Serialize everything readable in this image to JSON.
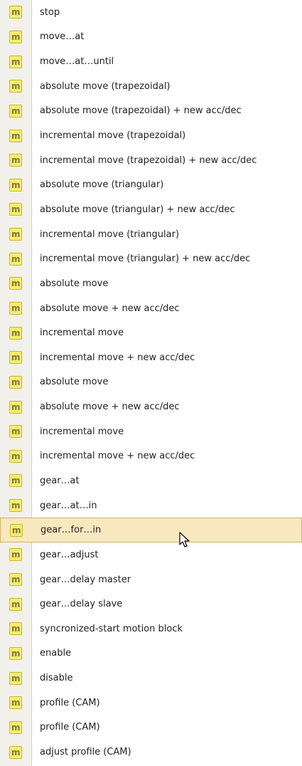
{
  "menu": {
    "icon_glyph": "m",
    "selected_index": 22,
    "items": [
      {
        "label": "stop",
        "icon": "method-icon"
      },
      {
        "label": "move…at",
        "icon": "method-icon"
      },
      {
        "label": "move…at…until",
        "icon": "method-icon"
      },
      {
        "label": "absolute move (trapezoidal)",
        "icon": "method-icon"
      },
      {
        "label": "absolute move (trapezoidal) + new acc/dec",
        "icon": "method-icon"
      },
      {
        "label": "incremental move (trapezoidal)",
        "icon": "method-icon"
      },
      {
        "label": "incremental move (trapezoidal) + new acc/dec",
        "icon": "method-icon"
      },
      {
        "label": "absolute move (triangular)",
        "icon": "method-icon"
      },
      {
        "label": "absolute move (triangular) + new acc/dec",
        "icon": "method-icon"
      },
      {
        "label": "incremental move (triangular)",
        "icon": "method-icon"
      },
      {
        "label": "incremental move (triangular) + new acc/dec",
        "icon": "method-icon"
      },
      {
        "label": "absolute move",
        "icon": "method-icon"
      },
      {
        "label": "absolute move + new acc/dec",
        "icon": "method-icon"
      },
      {
        "label": "incremental move",
        "icon": "method-icon"
      },
      {
        "label": "incremental move + new acc/dec",
        "icon": "method-icon"
      },
      {
        "label": "absolute move",
        "icon": "method-icon"
      },
      {
        "label": "absolute move + new acc/dec",
        "icon": "method-icon"
      },
      {
        "label": "incremental move",
        "icon": "method-icon"
      },
      {
        "label": "incremental move + new acc/dec",
        "icon": "method-icon"
      },
      {
        "label": "gear…at",
        "icon": "method-icon"
      },
      {
        "label": "gear…at…in",
        "icon": "method-icon"
      },
      {
        "label": "gear…for…in",
        "icon": "method-icon"
      },
      {
        "label": "gear…adjust",
        "icon": "method-icon"
      },
      {
        "label": "gear…delay master",
        "icon": "method-icon"
      },
      {
        "label": "gear…delay slave",
        "icon": "method-icon"
      },
      {
        "label": "syncronized-start motion block",
        "icon": "method-icon"
      },
      {
        "label": "enable",
        "icon": "method-icon"
      },
      {
        "label": "disable",
        "icon": "method-icon"
      },
      {
        "label": "profile (CAM)",
        "icon": "method-icon"
      },
      {
        "label": "profile (CAM)",
        "icon": "method-icon"
      },
      {
        "label": "adjust profile (CAM)",
        "icon": "method-icon"
      }
    ]
  },
  "colors": {
    "icon_fill": "#f7ef63",
    "icon_border": "#c2b63f",
    "selection_fill": "#f8e8bf",
    "selection_border": "#d9b15b"
  }
}
